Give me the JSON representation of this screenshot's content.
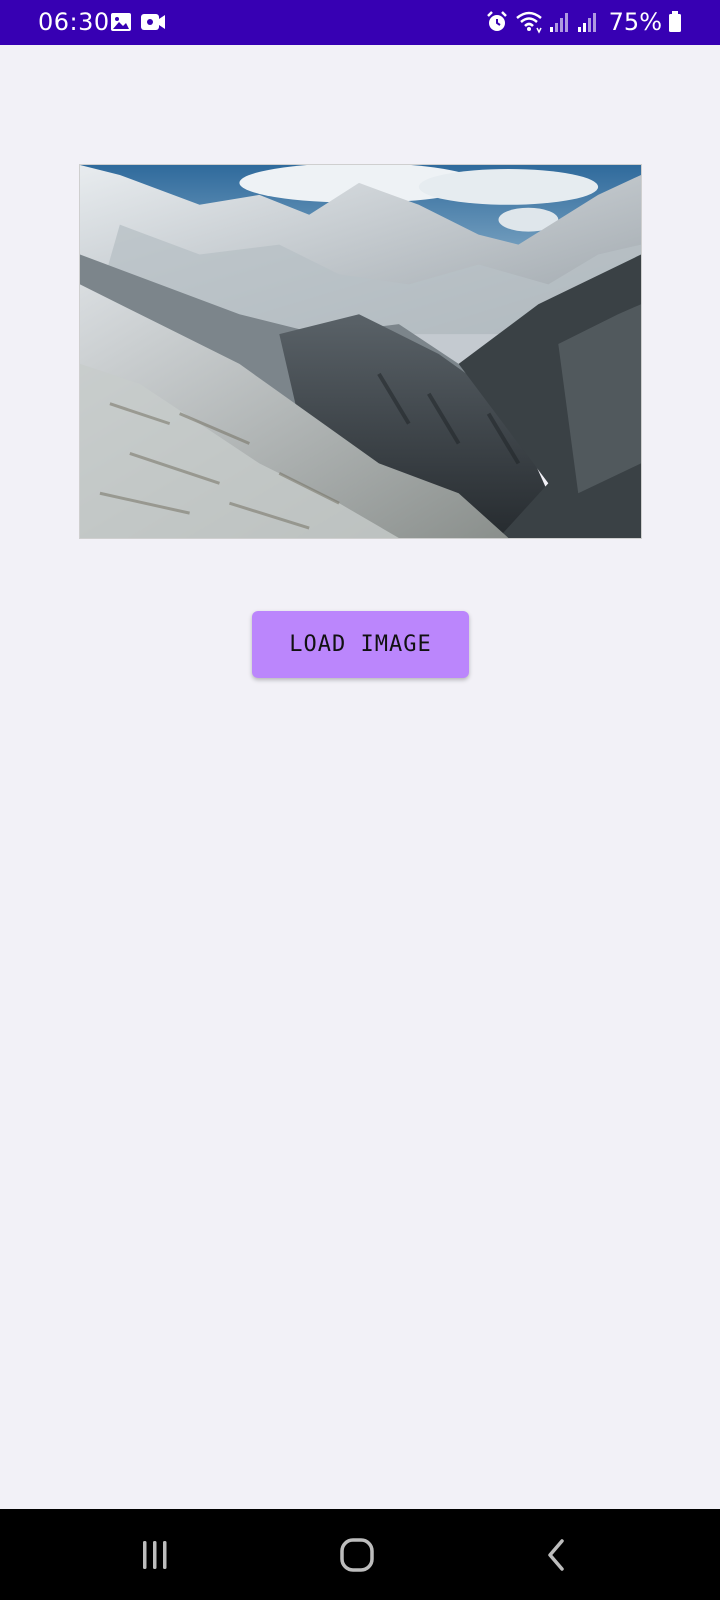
{
  "status_bar": {
    "time": "06:30",
    "battery": "75%",
    "background": "#3700b3",
    "left_icons": [
      "image-icon",
      "video-camera-icon"
    ],
    "right_icons": [
      "alarm-icon",
      "wifi-icon",
      "signal-icon",
      "signal-icon",
      "battery-icon"
    ]
  },
  "main": {
    "image_alt": "Snowy Himalayan mountain valley",
    "load_button_label": "LOAD IMAGE",
    "button_color": "#bb86fc",
    "background": "#f2f1f7"
  },
  "nav_bar": {
    "buttons": [
      "recent-apps-icon",
      "home-icon",
      "back-icon"
    ],
    "background": "#000000"
  }
}
